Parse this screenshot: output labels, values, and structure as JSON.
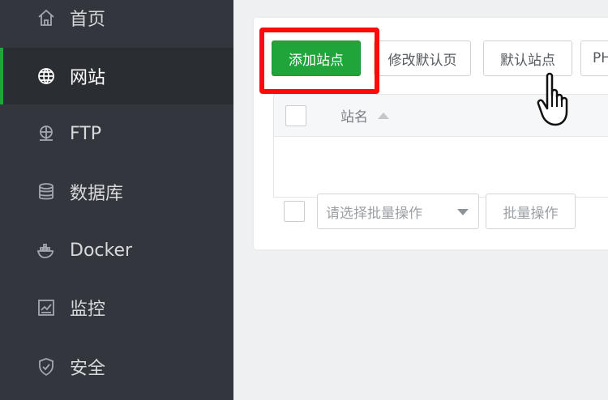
{
  "sidebar": {
    "items": [
      {
        "label": "首页",
        "icon": "home-icon"
      },
      {
        "label": "网站",
        "icon": "globe-icon",
        "active": true
      },
      {
        "label": "FTP",
        "icon": "ftp-icon"
      },
      {
        "label": "数据库",
        "icon": "database-icon"
      },
      {
        "label": "Docker",
        "icon": "docker-icon"
      },
      {
        "label": "监控",
        "icon": "monitor-icon"
      },
      {
        "label": "安全",
        "icon": "shield-icon"
      }
    ]
  },
  "toolbar": {
    "add_site": "添加站点",
    "edit_default_page": "修改默认页",
    "default_site": "默认站点",
    "php_truncated": "PH"
  },
  "table": {
    "col_site_name": "站名"
  },
  "batch": {
    "select_placeholder": "请选择批量操作",
    "button": "批量操作"
  },
  "colors": {
    "primary": "#20a53a",
    "highlight": "#ff0a0a",
    "sidebar_bg": "#33373d"
  }
}
